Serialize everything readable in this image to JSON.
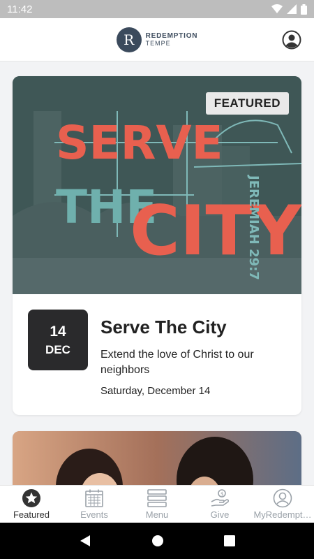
{
  "status_bar": {
    "time": "11:42"
  },
  "header": {
    "logo_letter": "R",
    "logo_line1": "REDEMPTION",
    "logo_line2": "TEMPE"
  },
  "featured_card": {
    "badge": "FEATURED",
    "artwork": {
      "word1": "SERVE",
      "word2": "THE",
      "word3": "CITY",
      "verse": "JEREMIAH 29:7"
    },
    "date_day": "14",
    "date_month": "DEC",
    "title": "Serve The City",
    "description": "Extend the love of Christ to our neighbors",
    "when": "Saturday, December 14"
  },
  "bottom_nav": {
    "items": [
      {
        "label": "Featured",
        "icon": "star-icon",
        "active": true
      },
      {
        "label": "Events",
        "icon": "calendar-icon",
        "active": false
      },
      {
        "label": "Menu",
        "icon": "menu-icon",
        "active": false
      },
      {
        "label": "Give",
        "icon": "give-icon",
        "active": false
      },
      {
        "label": "MyRedempt…",
        "icon": "person-icon",
        "active": false
      }
    ]
  },
  "colors": {
    "accent_red": "#e8604f",
    "teal": "#6fb0ad",
    "hero_bg": "#3f5756",
    "date_tile": "#2a2a2c"
  }
}
